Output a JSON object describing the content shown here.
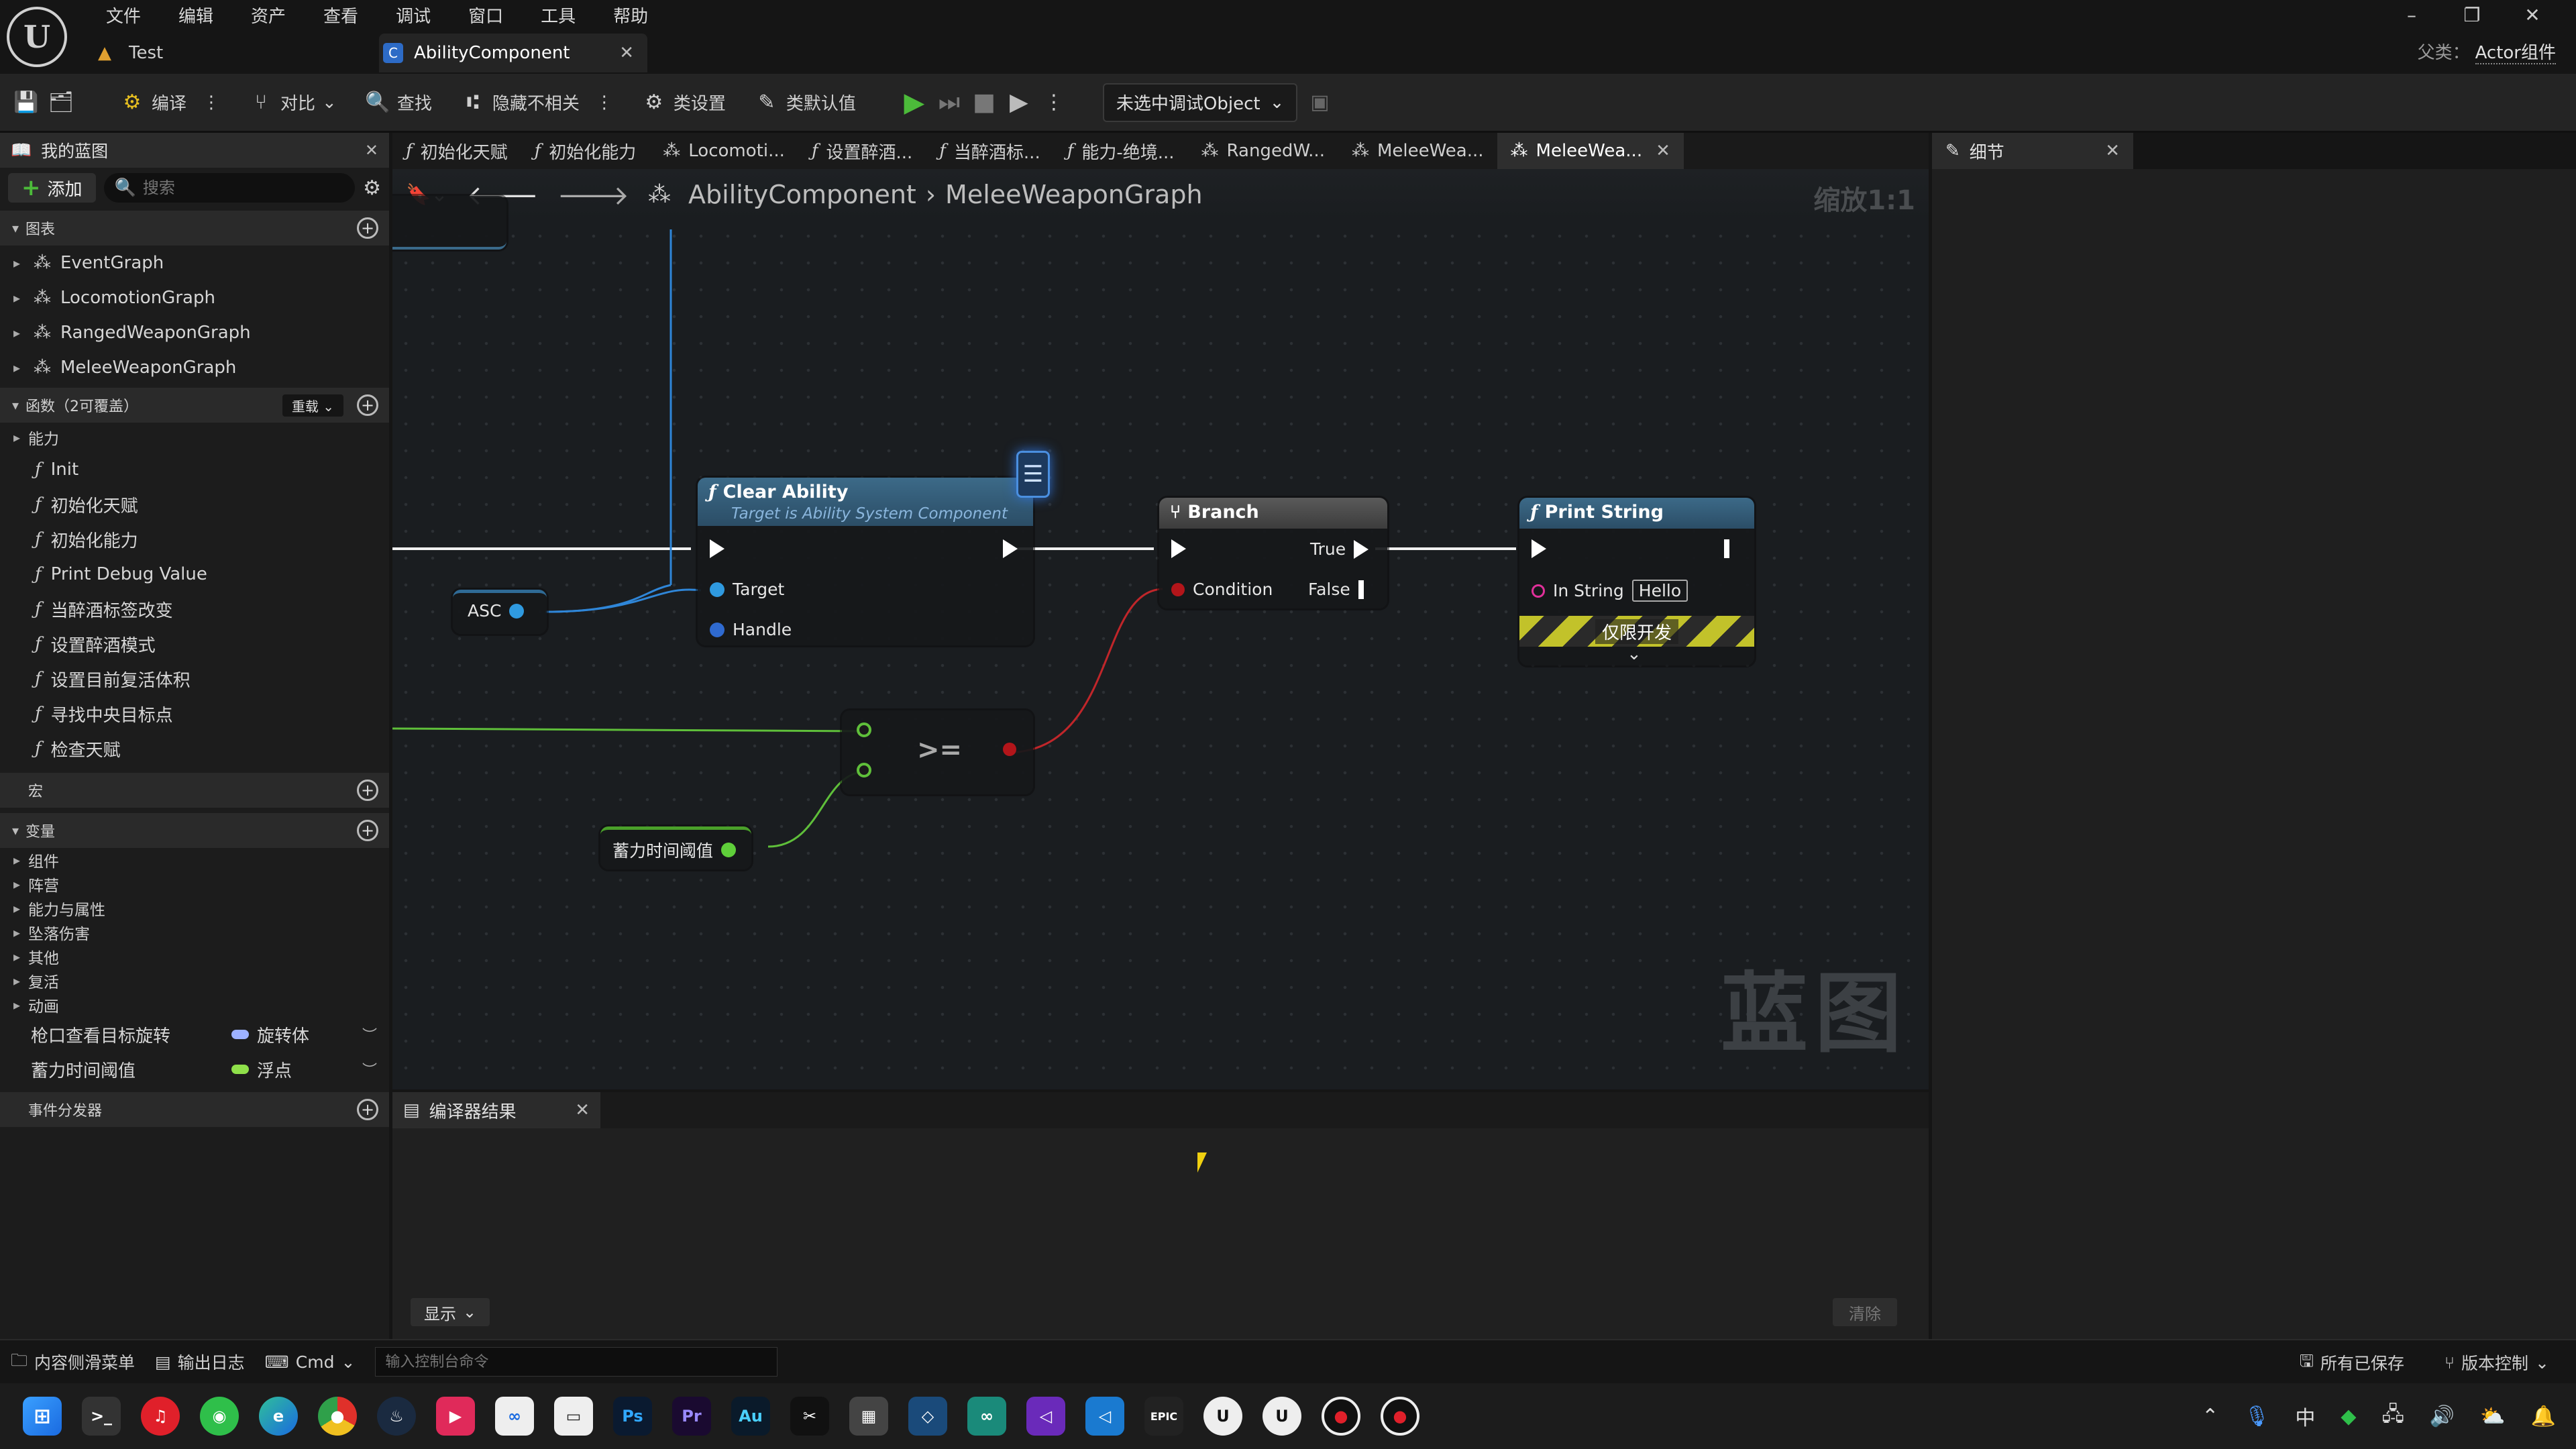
{
  "menu": [
    "文件",
    "编辑",
    "资产",
    "查看",
    "调试",
    "窗口",
    "工具",
    "帮助"
  ],
  "doc_tabs": [
    {
      "label": "Test"
    },
    {
      "label": "AbilityComponent"
    }
  ],
  "parent_class": {
    "label": "父类：",
    "value": "Actor组件"
  },
  "toolbar": {
    "compile": "编译",
    "diff": "对比",
    "find": "查找",
    "hide_unrelated": "隐藏不相关",
    "class_settings": "类设置",
    "class_defaults": "类默认值",
    "debug_object": "未选中调试Object"
  },
  "my_blueprint": {
    "tab_label": "我的蓝图",
    "add_label": "添加",
    "search_placeholder": "搜索",
    "graphs_header": "图表",
    "graphs": [
      "EventGraph",
      "LocomotionGraph",
      "RangedWeaponGraph",
      "MeleeWeaponGraph"
    ],
    "functions_header": "函数（2可覆盖）",
    "override_label": "重载",
    "function_category": "能力",
    "functions": [
      "Init",
      "初始化天赋",
      "初始化能力",
      "Print Debug Value",
      "当醉酒标签改变",
      "设置醉酒模式",
      "设置目前复活体积",
      "寻找中央目标点",
      "检查天赋"
    ],
    "macros_header": "宏",
    "variables_header": "变量",
    "variable_categories": [
      "组件",
      "阵营",
      "能力与属性",
      "坠落伤害",
      "其他",
      "复活",
      "动画"
    ],
    "variables": [
      {
        "name": "枪口查看目标旋转",
        "type": "旋转体",
        "color": "#9db1ff"
      },
      {
        "name": "蓄力时间阈值",
        "type": "浮点",
        "color": "#8fe04a"
      }
    ],
    "dispatchers_header": "事件分发器"
  },
  "graph_tabs": [
    {
      "label": "初始化天赋",
      "kind": "function"
    },
    {
      "label": "初始化能力",
      "kind": "function"
    },
    {
      "label": "Locomoti...",
      "kind": "graph"
    },
    {
      "label": "设置醉酒...",
      "kind": "function"
    },
    {
      "label": "当醉酒标...",
      "kind": "function"
    },
    {
      "label": "能力-绝境...",
      "kind": "function"
    },
    {
      "label": "RangedW...",
      "kind": "graph"
    },
    {
      "label": "MeleeWea...",
      "kind": "graph"
    },
    {
      "label": "MeleeWea...",
      "kind": "graph",
      "active": true
    }
  ],
  "graph": {
    "breadcrumb_root": "AbilityComponent",
    "breadcrumb_current": "MeleeWeaponGraph",
    "zoom": "缩放1:1",
    "watermark": "蓝图",
    "nodes": {
      "asc": {
        "label": "ASC"
      },
      "clear_ability": {
        "title": "Clear Ability",
        "subtitle": "Target is Ability System Component",
        "pins": [
          "Target",
          "Handle"
        ]
      },
      "branch": {
        "title": "Branch",
        "condition": "Condition",
        "true_label": "True",
        "false_label": "False"
      },
      "print_string": {
        "title": "Print String",
        "in_string_label": "In String",
        "in_string_value": "Hello",
        "dev_only": "仅限开发"
      },
      "compare": {
        "label": ">="
      },
      "threshold": {
        "label": "蓄力时间阈值"
      }
    }
  },
  "details": {
    "tab_label": "细节"
  },
  "compiler": {
    "tab_label": "编译器结果",
    "show_label": "显示",
    "clear_label": "清除"
  },
  "statusbar": {
    "content_drawer": "内容侧滑菜单",
    "output_log": "输出日志",
    "cmd": "Cmd",
    "console_placeholder": "输入控制台命令",
    "all_saved": "所有已保存",
    "source_control": "版本控制"
  },
  "taskbar": {
    "icons": [
      "windows-start",
      "terminal",
      "netease-music",
      "wechat",
      "edge",
      "chrome",
      "steam",
      "app-red",
      "meta",
      "app-box",
      "photoshop",
      "premiere",
      "audition",
      "capcut",
      "calculator",
      "app-blue",
      "app-green",
      "visual-studio",
      "vscode",
      "epic-games",
      "unreal-engine",
      "unreal-engine-2",
      "record",
      "record-active"
    ],
    "ime": "中"
  }
}
